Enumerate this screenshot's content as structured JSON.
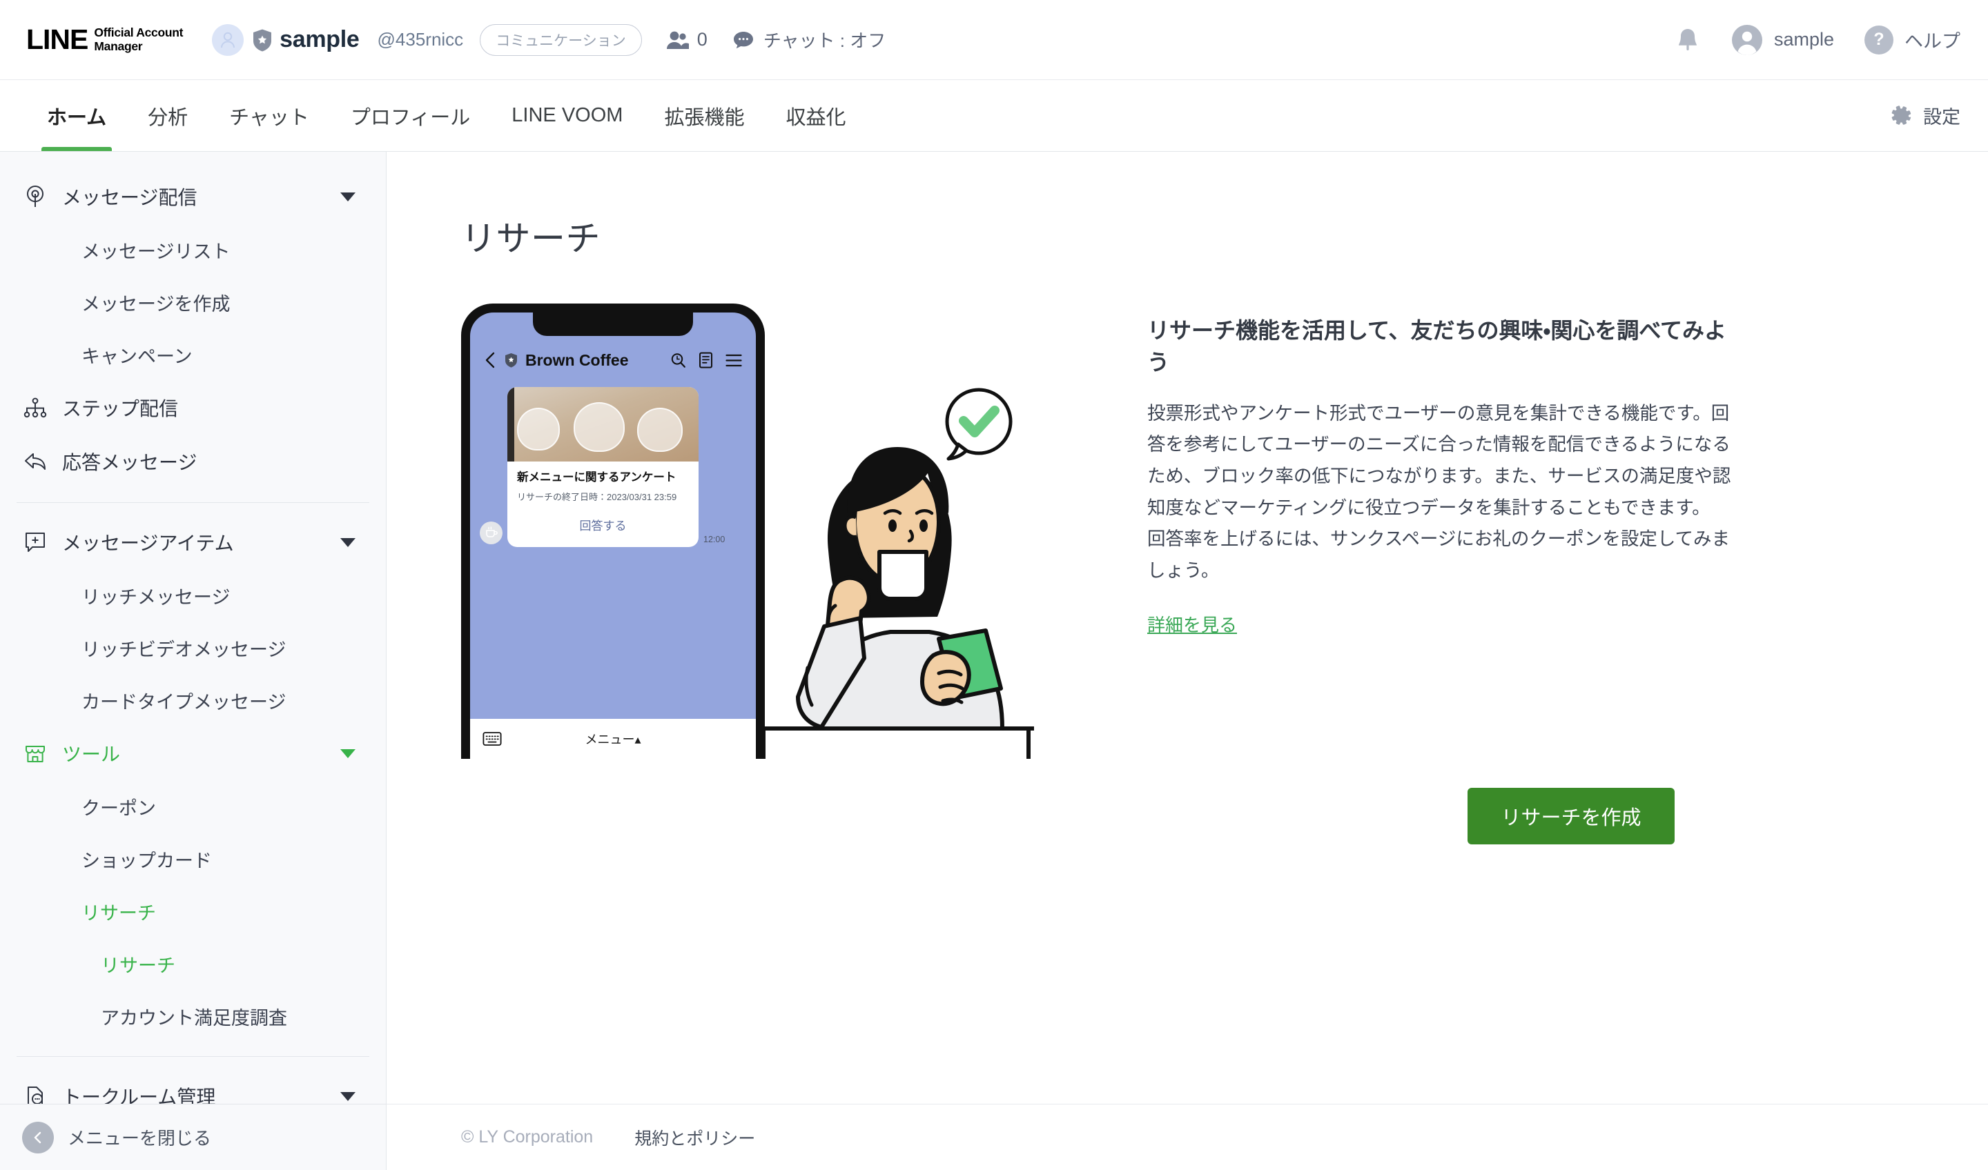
{
  "header": {
    "logo_main": "LINE",
    "logo_sub_line1": "Official Account",
    "logo_sub_line2": "Manager",
    "account_name": "sample",
    "account_id": "@435rnicc",
    "account_category": "コミュニケーション",
    "friend_count": "0",
    "chat_status": "チャット : オフ",
    "user_name": "sample",
    "help_label": "ヘルプ",
    "icons": {
      "avatar": "person-avatar-icon",
      "badge": "shield-star-icon",
      "friends": "friends-icon",
      "chat": "chat-bubble-icon",
      "bell": "bell-icon",
      "help": "question-mark-icon"
    }
  },
  "nav": {
    "tabs": [
      {
        "label": "ホーム",
        "active": true
      },
      {
        "label": "分析",
        "active": false
      },
      {
        "label": "チャット",
        "active": false
      },
      {
        "label": "プロフィール",
        "active": false
      },
      {
        "label": "LINE VOOM",
        "active": false
      },
      {
        "label": "拡張機能",
        "active": false
      },
      {
        "label": "収益化",
        "active": false
      }
    ],
    "settings_label": "設定",
    "settings_icon": "gear-icon"
  },
  "sidebar": {
    "groups": [
      {
        "parent": {
          "label": "メッセージ配信",
          "icon": "broadcast-icon",
          "expanded": true,
          "active": false
        },
        "children": [
          {
            "label": "メッセージリスト",
            "active": false
          },
          {
            "label": "メッセージを作成",
            "active": false
          },
          {
            "label": "キャンペーン",
            "active": false
          }
        ]
      },
      {
        "parent": {
          "label": "ステップ配信",
          "icon": "sitemap-icon",
          "expanded": false,
          "active": false
        },
        "children": []
      },
      {
        "parent": {
          "label": "応答メッセージ",
          "icon": "reply-arrow-icon",
          "expanded": false,
          "active": false
        },
        "children": []
      },
      {
        "parent": {
          "label": "メッセージアイテム",
          "icon": "add-message-icon",
          "expanded": true,
          "active": false
        },
        "children": [
          {
            "label": "リッチメッセージ",
            "active": false
          },
          {
            "label": "リッチビデオメッセージ",
            "active": false
          },
          {
            "label": "カードタイプメッセージ",
            "active": false
          }
        ]
      },
      {
        "parent": {
          "label": "ツール",
          "icon": "shop-icon",
          "expanded": true,
          "active": true
        },
        "children": [
          {
            "label": "クーポン",
            "active": false
          },
          {
            "label": "ショップカード",
            "active": false
          },
          {
            "label": "リサーチ",
            "active": true
          },
          {
            "label": "リサーチ",
            "active": true,
            "sub": true
          },
          {
            "label": "アカウント満足度調査",
            "active": false,
            "sub": true
          }
        ]
      },
      {
        "parent": {
          "label": "トークルーム管理",
          "icon": "talkroom-icon",
          "expanded": false,
          "active": false
        },
        "children": []
      }
    ],
    "collapse_label": "メニューを閉じる",
    "collapse_icon": "chevron-left-icon"
  },
  "main": {
    "page_title": "リサーチ",
    "promo_heading": "リサーチ機能を活用して、友だちの興味・関心を調べてみよう",
    "promo_body": "投票形式やアンケート形式でユーザーの意見を集計できる機能です。回答を参考にしてユーザーのニーズに合った情報を配信できるようになるため、ブロック率の低下につながります。また、サービスの満足度や認知度などマーケティングに役立つデータを集計することもできます。\n回答率を上げるには、サンクスページにお礼のクーポンを設定してみましょう。",
    "promo_link": "詳細を見る",
    "cta_label": "リサーチを作成"
  },
  "phone_preview": {
    "chat_title": "Brown Coffee",
    "back_icon": "chevron-left-icon",
    "verified_icon": "shield-star-icon",
    "header_icons": [
      "search-icon",
      "note-icon",
      "hamburger-menu-icon"
    ],
    "survey_title": "新メニューに関するアンケート",
    "survey_deadline": "リサーチの終了日時：2023/03/31 23:59",
    "survey_cta": "回答する",
    "message_time": "12:00",
    "bottom_menu_label": "メニュー▴",
    "keyboard_icon": "keyboard-icon",
    "avatar_icon": "coffee-cup-icon"
  },
  "illustration": {
    "name": "woman-drinking-coffee-with-phone",
    "check_bubble_icon": "check-mark-icon",
    "check_color": "#6ACB83",
    "phone_color": "#52C77A",
    "skin_color": "#F2CFA4",
    "hair_color": "#111111",
    "shirt_color": "#ECEDEF"
  },
  "footer": {
    "copyright": "© LY Corporation",
    "terms_link": "規約とポリシー"
  },
  "colors": {
    "brand_green": "#4CAF50",
    "active_green": "#38b349",
    "cta_green": "#3a8a28",
    "link_green": "#3aa856",
    "sidebar_bg": "#f8f9fb",
    "text_primary": "#3c4043",
    "text_muted": "#6b7a90"
  }
}
